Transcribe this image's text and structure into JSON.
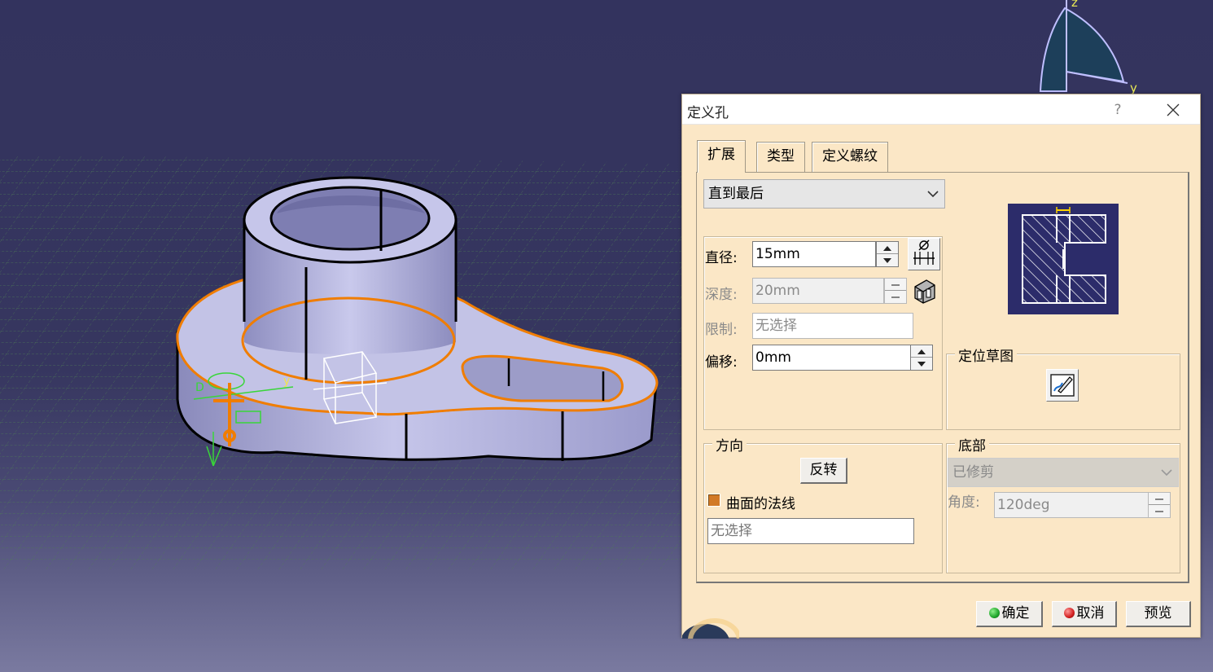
{
  "viewport": {
    "axis": {
      "z_label": "z",
      "y_label": "y"
    },
    "colors": {
      "background": "#33335e",
      "part_fill": "#b9b9df",
      "selection": "#f07d00",
      "grid": "#5a8a5a"
    }
  },
  "dialog": {
    "title": "定义孔",
    "help_label": "?",
    "tabs": [
      {
        "label": "扩展",
        "active": true
      },
      {
        "label": "类型",
        "active": false
      },
      {
        "label": "定义螺纹",
        "active": false
      }
    ],
    "extension_type": "直到最后",
    "diameter": {
      "label": "直径:",
      "value": "15mm"
    },
    "depth": {
      "label": "深度:",
      "value": "20mm",
      "enabled": false
    },
    "limit": {
      "label": "限制:",
      "value": "无选择",
      "enabled": false
    },
    "offset": {
      "label": "偏移:",
      "value": "0mm"
    },
    "positioning_sketch": {
      "title": "定位草图",
      "icon": "sketcher-icon"
    },
    "direction": {
      "title": "方向",
      "reverse_label": "反转",
      "surface_normal_label": "曲面的法线",
      "surface_normal_checked": true,
      "selection_value": "无选择"
    },
    "bottom": {
      "title": "底部",
      "type_value": "已修剪",
      "angle_label": "角度:",
      "angle_value": "120deg",
      "enabled": false
    },
    "buttons": {
      "ok_label": "确定",
      "cancel_label": "取消",
      "preview_label": "预览"
    },
    "colors": {
      "dialog_bg": "#fbe7c6",
      "ok_ball": "#1fa52b",
      "cancel_ball": "#d21f1f",
      "preview_image_bg": "#2c2c6a"
    }
  }
}
